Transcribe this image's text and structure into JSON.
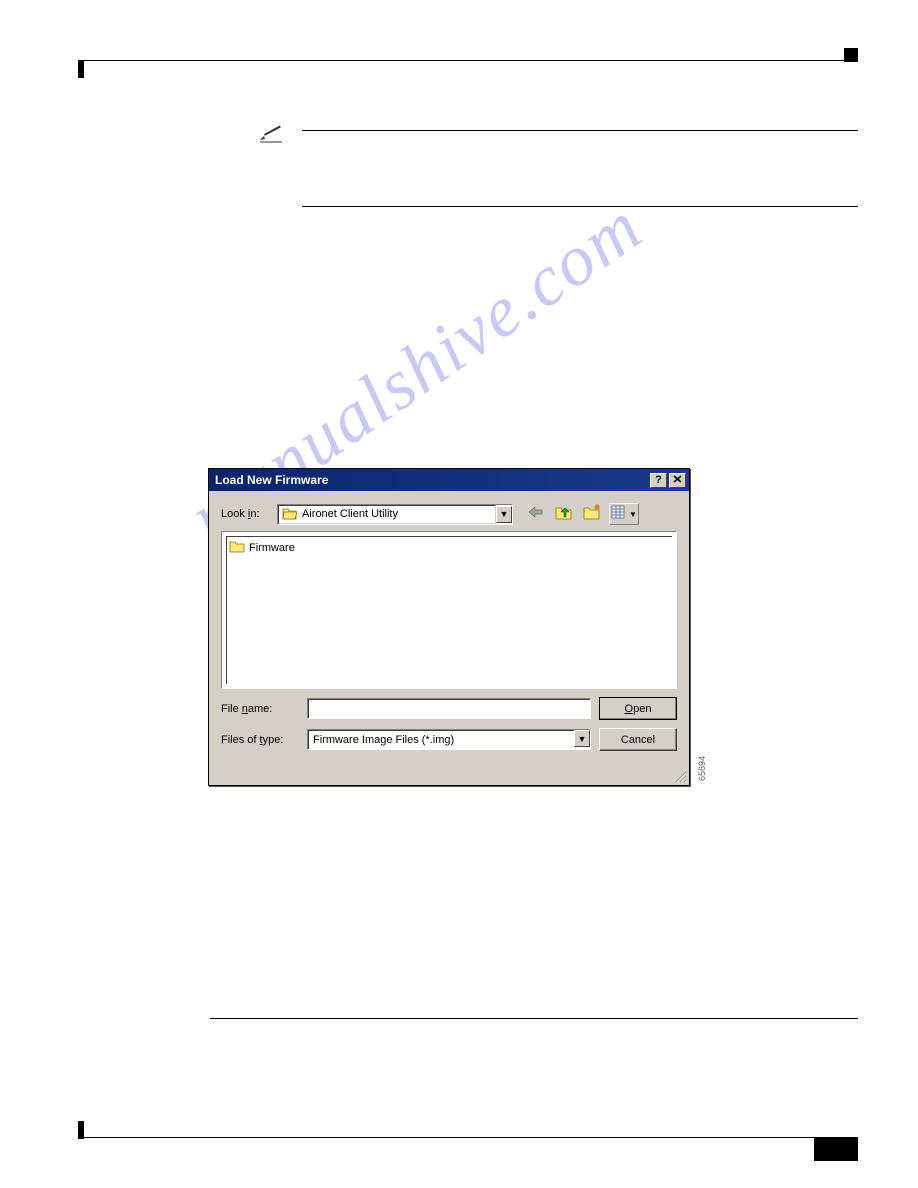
{
  "dialog": {
    "title": "Load New Firmware",
    "lookin_label": "Look in:",
    "lookin_value": "Aironet Client Utility",
    "file_list": [
      {
        "name": "Firmware",
        "type": "folder"
      }
    ],
    "filename_label": "File name:",
    "filename_value": "",
    "filetype_label": "Files of type:",
    "filetype_value": "Firmware Image Files (*.img)",
    "open_button": "Open",
    "cancel_button": "Cancel"
  },
  "side_number": "65694",
  "watermark": "manualshive.com"
}
